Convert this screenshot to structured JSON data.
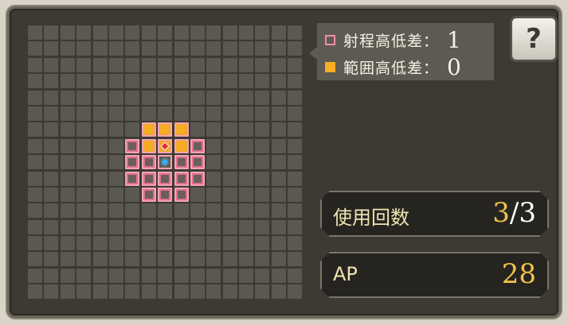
{
  "legend": {
    "range": {
      "label": "射程高低差：",
      "value": "1",
      "color": "#f08fa7"
    },
    "area": {
      "label": "範囲高低差：",
      "value": "0",
      "color": "#f6ad24"
    }
  },
  "help_icon": "help-book-icon",
  "usage": {
    "label": "使用回数",
    "current": "3",
    "separator": "/",
    "max": "3"
  },
  "ap": {
    "label": "AP",
    "value": "28"
  },
  "grid": {
    "size": 17,
    "range_cells": [
      [
        7,
        6
      ],
      [
        7,
        10
      ],
      [
        8,
        6
      ],
      [
        8,
        7
      ],
      [
        8,
        9
      ],
      [
        8,
        10
      ],
      [
        9,
        6
      ],
      [
        9,
        7
      ],
      [
        9,
        8
      ],
      [
        9,
        9
      ],
      [
        9,
        10
      ],
      [
        10,
        7
      ],
      [
        10,
        8
      ],
      [
        10,
        9
      ]
    ],
    "area_cells": [
      [
        6,
        7
      ],
      [
        6,
        8
      ],
      [
        6,
        9
      ],
      [
        7,
        7
      ],
      [
        7,
        9
      ]
    ],
    "target_cell": [
      7,
      8
    ],
    "origin_cell": [
      8,
      8
    ]
  }
}
